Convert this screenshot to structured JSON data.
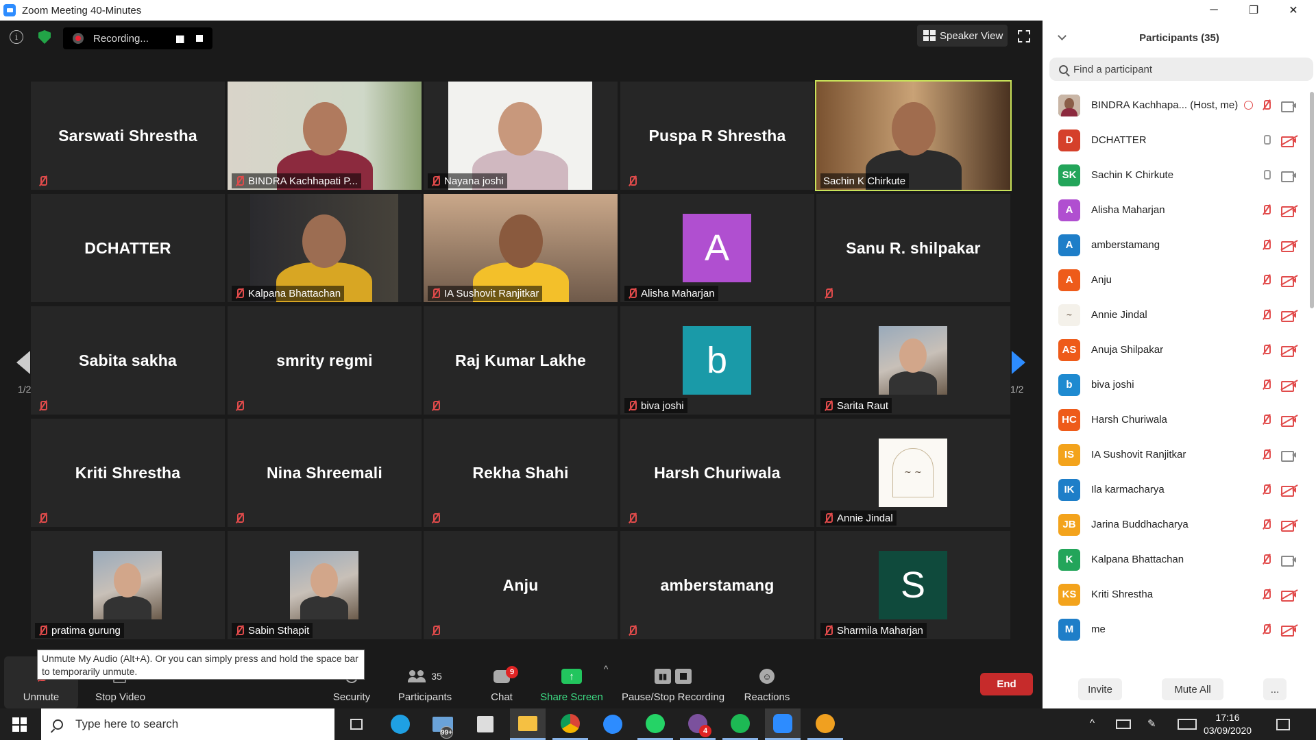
{
  "window": {
    "title": "Zoom Meeting 40-Minutes",
    "minimize": "─",
    "restore": "❐",
    "close": "✕"
  },
  "top": {
    "recording_label": "Recording...",
    "speaker_view_label": "Speaker View"
  },
  "tiles": [
    {
      "name": "Sarswati Shrestha",
      "kind": "name",
      "muted": true
    },
    {
      "name": "BINDRA Kachhapati P...",
      "kind": "photo",
      "muted": true
    },
    {
      "name": "Nayana joshi",
      "kind": "photo",
      "muted": true
    },
    {
      "name": "Puspa R Shrestha",
      "kind": "name",
      "muted": true
    },
    {
      "name": "Sachin K Chirkute",
      "kind": "photo",
      "muted": false,
      "active": true
    },
    {
      "name": "DCHATTER",
      "kind": "name",
      "muted": false
    },
    {
      "name": "Kalpana Bhattachan",
      "kind": "photo",
      "muted": true
    },
    {
      "name": "IA Sushovit Ranjitkar",
      "kind": "photo",
      "muted": true
    },
    {
      "name": "Alisha Maharjan",
      "kind": "avatar",
      "letter": "A",
      "color": "#b04fd0",
      "muted": true
    },
    {
      "name": "Sanu R. shilpakar",
      "kind": "name",
      "muted": true
    },
    {
      "name": "Sabita sakha",
      "kind": "name",
      "muted": true
    },
    {
      "name": "smrity regmi",
      "kind": "name",
      "muted": true
    },
    {
      "name": "Raj Kumar Lakhe",
      "kind": "name",
      "muted": true
    },
    {
      "name": "biva joshi",
      "kind": "avatar",
      "letter": "b",
      "color": "#1a9aa8",
      "muted": true
    },
    {
      "name": "Sarita Raut",
      "kind": "thumb",
      "muted": true
    },
    {
      "name": "Kriti Shrestha",
      "kind": "name",
      "muted": true
    },
    {
      "name": "Nina Shreemali",
      "kind": "name",
      "muted": true
    },
    {
      "name": "Rekha Shahi",
      "kind": "name",
      "muted": true
    },
    {
      "name": "Harsh Churiwala",
      "kind": "name",
      "muted": true
    },
    {
      "name": "Annie Jindal",
      "kind": "logo",
      "muted": true
    },
    {
      "name": "pratima gurung",
      "kind": "thumb",
      "muted": true
    },
    {
      "name": "Sabin Sthapit",
      "kind": "thumb",
      "muted": true
    },
    {
      "name": "Anju",
      "kind": "name",
      "muted": true
    },
    {
      "name": "amberstamang",
      "kind": "name",
      "muted": true
    },
    {
      "name": "Sharmila Maharjan",
      "kind": "avatar",
      "letter": "S",
      "color": "#0f4a3c",
      "muted": true
    }
  ],
  "pager": {
    "left": "1/2",
    "right": "1/2"
  },
  "tooltip": "Unmute My Audio (Alt+A). Or you can simply press and hold the space bar to temporarily unmute.",
  "toolbar": {
    "unmute": "Unmute",
    "stop_video": "Stop Video",
    "security": "Security",
    "participants": "Participants",
    "participants_count": "35",
    "chat": "Chat",
    "chat_badge": "9",
    "share_screen": "Share Screen",
    "recording": "Pause/Stop Recording",
    "reactions": "Reactions",
    "end": "End"
  },
  "panel": {
    "title": "Participants (35)",
    "search_placeholder": "Find a participant",
    "invite": "Invite",
    "mute_all": "Mute All",
    "more": "...",
    "participants": [
      {
        "name": "BINDRA Kachhapa... (Host, me)",
        "initials": "",
        "color": "#7a5a4a",
        "mic": "muted",
        "video": "on",
        "photo": true,
        "rec": true
      },
      {
        "name": "DCHATTER",
        "initials": "D",
        "color": "#d5402b",
        "mic": "on",
        "video": "off"
      },
      {
        "name": "Sachin K Chirkute",
        "initials": "SK",
        "color": "#23a55a",
        "mic": "on",
        "video": "on"
      },
      {
        "name": "Alisha Maharjan",
        "initials": "A",
        "color": "#b04fd0",
        "mic": "muted",
        "video": "off"
      },
      {
        "name": "amberstamang",
        "initials": "A",
        "color": "#1e7ec8",
        "mic": "muted",
        "video": "off"
      },
      {
        "name": "Anju",
        "initials": "A",
        "color": "#ee5b1a",
        "mic": "muted",
        "video": "off"
      },
      {
        "name": "Annie Jindal",
        "initials": "",
        "color": "#f4f1ea",
        "mic": "muted",
        "video": "off",
        "logo": true
      },
      {
        "name": "Anuja Shilpakar",
        "initials": "AS",
        "color": "#ee5b1a",
        "mic": "muted",
        "video": "off"
      },
      {
        "name": "biva joshi",
        "initials": "b",
        "color": "#1e8ad0",
        "mic": "muted",
        "video": "off"
      },
      {
        "name": "Harsh Churiwala",
        "initials": "HC",
        "color": "#ee5b1a",
        "mic": "muted",
        "video": "off"
      },
      {
        "name": "IA Sushovit Ranjitkar",
        "initials": "IS",
        "color": "#f3a31c",
        "mic": "muted",
        "video": "on"
      },
      {
        "name": "Ila karmacharya",
        "initials": "IK",
        "color": "#1e7ec8",
        "mic": "muted",
        "video": "off"
      },
      {
        "name": "Jarina Buddhacharya",
        "initials": "JB",
        "color": "#f3a31c",
        "mic": "muted",
        "video": "off"
      },
      {
        "name": "Kalpana Bhattachan",
        "initials": "K",
        "color": "#23a55a",
        "mic": "muted",
        "video": "on"
      },
      {
        "name": "Kriti Shrestha",
        "initials": "KS",
        "color": "#f3a31c",
        "mic": "muted",
        "video": "off"
      },
      {
        "name": "me",
        "initials": "M",
        "color": "#1e7ec8",
        "mic": "muted",
        "video": "off"
      }
    ]
  },
  "taskbar": {
    "search_placeholder": "Type here to search",
    "time": "17:16",
    "date": "03/09/2020",
    "mail_badge": "99+",
    "viber_badge": "4"
  },
  "colors": {
    "accent": "#2d8cff",
    "muted_red": "#e14b4b",
    "end_red": "#c62b2b",
    "active_speaker": "#c9e35a",
    "share_green": "#22c55e"
  }
}
